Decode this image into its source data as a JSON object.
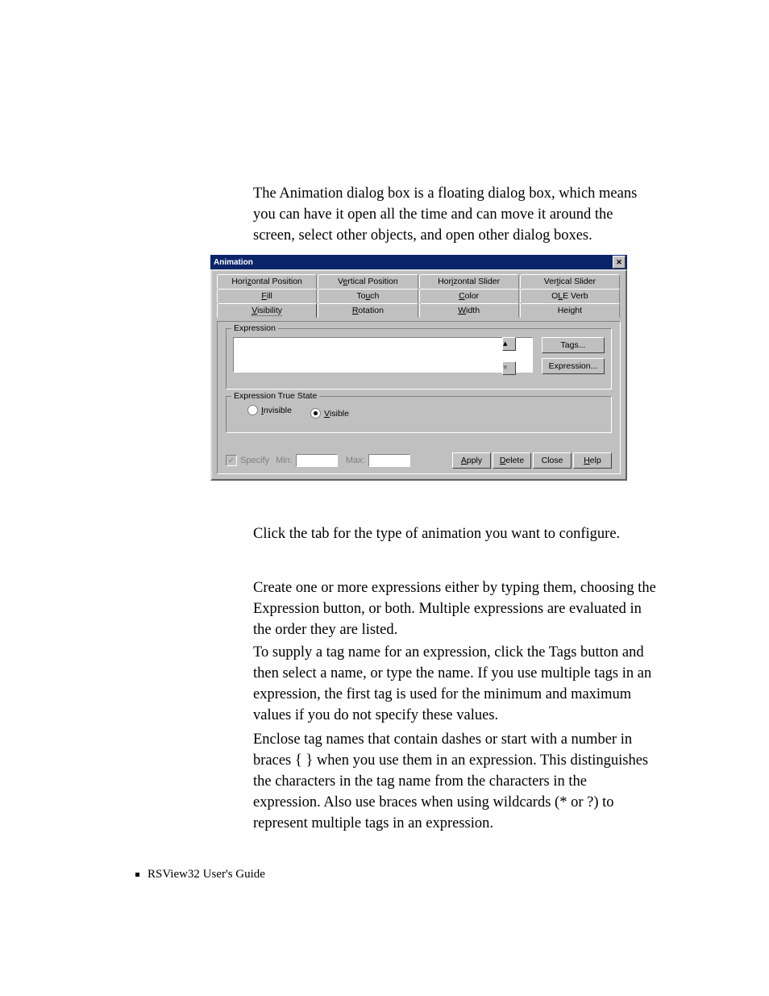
{
  "body": {
    "intro": "The Animation dialog box is a floating dialog box, which means you can have it open all the time and can move it around the screen, select other objects, and open other dialog boxes.",
    "tabtext": "Click the tab for the type of animation you want to configure.",
    "para2": "Create one or more expressions either by typing them, choosing the Expression button, or both. Multiple expressions are evaluated in the order they are listed.",
    "para3": "To supply a tag name for an expression, click the Tags button and then select a name, or type the name. If you use multiple tags in an expression, the first tag is used for the minimum and maximum values if you do not specify these values.",
    "para4": "Enclose tag names that contain dashes or start with a number in braces { } when you use them in an expression. This distinguishes the characters in the tag name from the characters in the expression. Also use braces when using wildcards (* or ?) to represent multiple tags in an expression."
  },
  "dialog": {
    "title": "Animation",
    "tabs": [
      {
        "pre": "Hori",
        "u": "z",
        "post": "ontal Position"
      },
      {
        "pre": "V",
        "u": "e",
        "post": "rtical Position"
      },
      {
        "pre": "Hor",
        "u": "i",
        "post": "zontal Slider"
      },
      {
        "pre": "Ver",
        "u": "t",
        "post": "ical Slider"
      },
      {
        "u": "F",
        "post": "ill"
      },
      {
        "pre": "To",
        "u": "u",
        "post": "ch"
      },
      {
        "u": "C",
        "post": "olor"
      },
      {
        "pre": "O",
        "u": "L",
        "post": "E Verb"
      },
      {
        "u": "V",
        "post": "isibility"
      },
      {
        "u": "R",
        "post": "otation"
      },
      {
        "u": "W",
        "post": "idth"
      },
      {
        "pre": "Hei",
        "u": "g",
        "post": "ht"
      }
    ],
    "expression_group": "Expression",
    "tags_btn": "Tags...",
    "expr_btn": "Expression...",
    "true_state_group": "Expression True State",
    "radios": [
      {
        "u": "I",
        "post": "nvisible"
      },
      {
        "u": "V",
        "post": "isible"
      }
    ],
    "specify": "Specify",
    "min": "Min:",
    "max": "Max:",
    "buttons": [
      {
        "u": "A",
        "post": "pply"
      },
      {
        "u": "D",
        "post": "elete"
      },
      {
        "pre": "Close"
      },
      {
        "u": "H",
        "post": "elp"
      }
    ]
  },
  "footer": {
    "text": "RSView32  User's Guide"
  }
}
